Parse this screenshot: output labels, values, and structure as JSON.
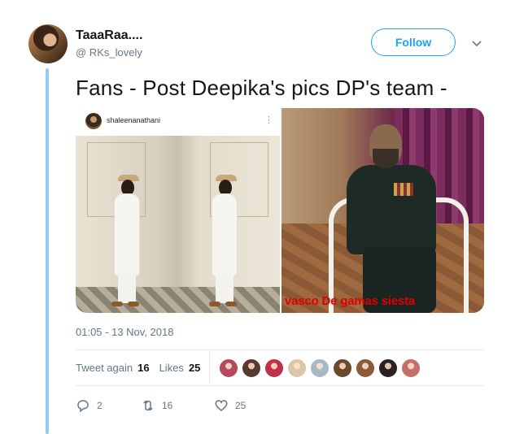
{
  "user": {
    "display_name": "TaaaRaa....",
    "handle": "@ RKs_lovely"
  },
  "follow_label": "Follow",
  "tweet": {
    "text": "Fans - Post Deepika's pics DP's team -"
  },
  "media": {
    "left": {
      "insta_username": "shaleenanathani",
      "menu_glyph": "⋮"
    },
    "right": {
      "caption": "vasco De gamas siesta"
    }
  },
  "timestamp": "01:05 - 13 Nov, 2018",
  "stats": {
    "retweets_label": "Tweet again",
    "retweets_count": "16",
    "likes_label": "Likes",
    "likes_count": "25"
  },
  "likers": [
    {
      "icon": "avatar-woman-red",
      "color": "#b5485a"
    },
    {
      "icon": "avatar-woman-dark",
      "color": "#5a3a2e"
    },
    {
      "icon": "avatar-woman-red2",
      "color": "#c0304a"
    },
    {
      "icon": "avatar-dog",
      "color": "#d9c7a8"
    },
    {
      "icon": "avatar-default",
      "color": "#aab8c2"
    },
    {
      "icon": "avatar-woman-gold",
      "color": "#6a4a2a"
    },
    {
      "icon": "avatar-woman-brown",
      "color": "#8a5a3a"
    },
    {
      "icon": "avatar-woman-black",
      "color": "#2a2220"
    },
    {
      "icon": "avatar-woman-pink",
      "color": "#c2706a"
    }
  ],
  "actions": {
    "reply_count": "2",
    "retweet_count": "16",
    "like_count": "25"
  },
  "colors": {
    "accent": "#1da1f2",
    "thread": "#90cdf4",
    "muted": "#657786",
    "caption": "#e00000"
  }
}
